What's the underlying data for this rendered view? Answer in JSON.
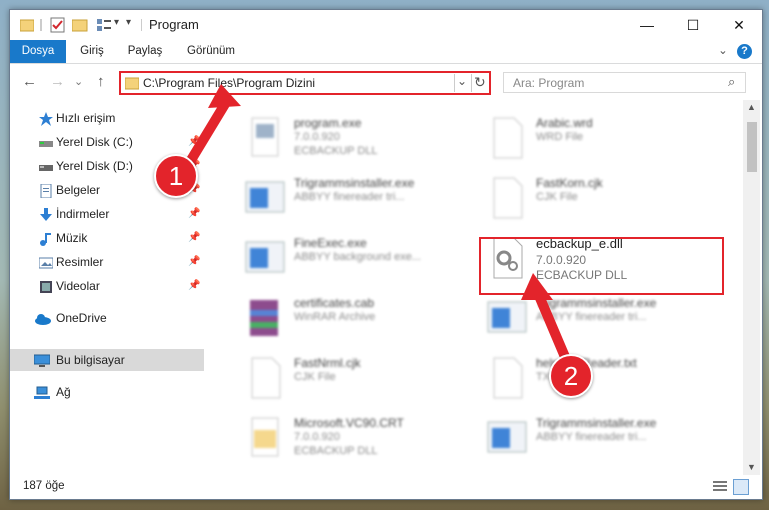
{
  "window": {
    "title": "Program",
    "controls": {
      "minimize": "—",
      "maximize": "☐",
      "close": "✕"
    }
  },
  "ribbon": {
    "tabs": [
      {
        "label": "Dosya",
        "active": true
      },
      {
        "label": "Giriş",
        "active": false
      },
      {
        "label": "Paylaş",
        "active": false
      },
      {
        "label": "Görünüm",
        "active": false
      }
    ],
    "expand_glyph": "⌄",
    "help_glyph": "?"
  },
  "address": {
    "path": "C:\\Program Files\\Program Dizini",
    "search_placeholder": "Ara: Program"
  },
  "nav_glyphs": {
    "back": "←",
    "forward": "→",
    "up": "↑",
    "dropdown": "⌄",
    "refresh": "↻",
    "search": "⌕"
  },
  "sidebar": {
    "items": [
      {
        "label": "Hızlı erişim",
        "icon": "star-icon",
        "pinned": false
      },
      {
        "label": "Yerel Disk (C:)",
        "icon": "drive-icon",
        "pinned": true
      },
      {
        "label": "Yerel Disk (D:)",
        "icon": "drive-icon",
        "pinned": true
      },
      {
        "label": "Belgeler",
        "icon": "document-icon",
        "pinned": true
      },
      {
        "label": "İndirmeler",
        "icon": "download-icon",
        "pinned": true
      },
      {
        "label": "Müzik",
        "icon": "music-icon",
        "pinned": true
      },
      {
        "label": "Resimler",
        "icon": "pictures-icon",
        "pinned": true
      },
      {
        "label": "Videolar",
        "icon": "video-icon",
        "pinned": true
      },
      {
        "label": "OneDrive",
        "icon": "cloud-icon",
        "pinned": false
      },
      {
        "label": "Bu bilgisayar",
        "icon": "computer-icon",
        "pinned": false,
        "selected": true
      },
      {
        "label": "Ağ",
        "icon": "network-icon",
        "pinned": false
      }
    ],
    "pin_glyph": "📌"
  },
  "files": [
    {
      "name": "program.exe",
      "line1": "7.0.0.920",
      "line2": "ECBACKUP DLL",
      "icon": "exe-icon"
    },
    {
      "name": "Arabic.wrd",
      "line1": "WRD File",
      "line2": "",
      "icon": "file-icon"
    },
    {
      "name": "Trigrammsinstaller.exe",
      "line1": "ABBYY finereader tri...",
      "line2": "",
      "icon": "app-icon"
    },
    {
      "name": "FastKorn.cjk",
      "line1": "CJK File",
      "line2": "",
      "icon": "file-icon"
    },
    {
      "name": "FineExec.exe",
      "line1": "ABBYY background exe...",
      "line2": "",
      "icon": "app-icon"
    },
    {
      "name": "ecbackup_e.dll",
      "line1": "7.0.0.920",
      "line2": "ECBACKUP DLL",
      "icon": "dll-gear-icon",
      "highlight": true
    },
    {
      "name": "certificates.cab",
      "line1": "WinRAR Archive",
      "line2": "",
      "icon": "archive-icon"
    },
    {
      "name": "Trigrammsinstaller.exe",
      "line1": "ABBYY finereader tri...",
      "line2": "",
      "icon": "app-icon"
    },
    {
      "name": "FastNrml.cjk",
      "line1": "CJK File",
      "line2": "",
      "icon": "file-icon"
    },
    {
      "name": "help_pdfReader.txt",
      "line1": "TXT File",
      "line2": "",
      "icon": "file-icon"
    },
    {
      "name": "Microsoft.VC90.CRT",
      "line1": "7.0.0.920",
      "line2": "ECBACKUP DLL",
      "icon": "folder-file-icon"
    },
    {
      "name": "Trigrammsinstaller.exe",
      "line1": "ABBYY finereader tri...",
      "line2": "",
      "icon": "app-icon"
    }
  ],
  "status": {
    "item_count": "187 öğe"
  },
  "annotations": {
    "badge1": "1",
    "badge2": "2"
  },
  "colors": {
    "accent": "#1979ca",
    "highlight": "#e3242b"
  }
}
